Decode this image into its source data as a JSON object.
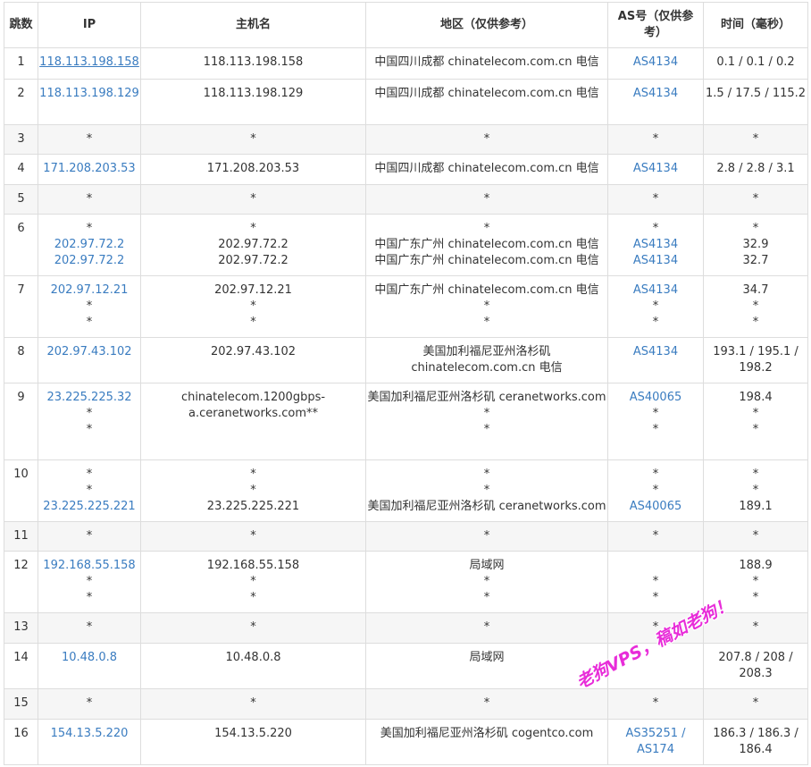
{
  "headers": {
    "hop": "跳数",
    "ip": "IP",
    "hostname": "主机名",
    "region": "地区（仅供参考）",
    "as": "AS号（仅供参考）",
    "time": "时间（毫秒）"
  },
  "rows": [
    {
      "hop": "1",
      "ip": [
        "118.113.198.158"
      ],
      "host": [
        "118.113.198.158"
      ],
      "region": [
        "中国四川成都 chinatelecom.com.cn 电信"
      ],
      "as": [
        "AS4134"
      ],
      "time": [
        "0.1 / 0.1 / 0.2"
      ]
    },
    {
      "hop": "2",
      "ip": [
        "118.113.198.129"
      ],
      "host": [
        "118.113.198.129"
      ],
      "region": [
        "中国四川成都 chinatelecom.com.cn 电信"
      ],
      "as": [
        "AS4134"
      ],
      "time": [
        "1.5 / 17.5 / 115.2"
      ]
    },
    {
      "hop": "3",
      "ip": [
        "*"
      ],
      "host": [
        "*"
      ],
      "region": [
        "*"
      ],
      "as": [
        "*"
      ],
      "time": [
        "*"
      ]
    },
    {
      "hop": "4",
      "ip": [
        "171.208.203.53"
      ],
      "host": [
        "171.208.203.53"
      ],
      "region": [
        "中国四川成都 chinatelecom.com.cn 电信"
      ],
      "as": [
        "AS4134"
      ],
      "time": [
        "2.8 / 2.8 / 3.1"
      ]
    },
    {
      "hop": "5",
      "ip": [
        "*"
      ],
      "host": [
        "*"
      ],
      "region": [
        "*"
      ],
      "as": [
        "*"
      ],
      "time": [
        "*"
      ]
    },
    {
      "hop": "6",
      "ip": [
        "*",
        "202.97.72.2",
        "202.97.72.2"
      ],
      "host": [
        "*",
        "202.97.72.2",
        "202.97.72.2"
      ],
      "region": [
        "*",
        "中国广东广州 chinatelecom.com.cn 电信",
        "中国广东广州 chinatelecom.com.cn 电信"
      ],
      "as": [
        "*",
        "AS4134",
        "AS4134"
      ],
      "time": [
        "*",
        "32.9",
        "32.7"
      ]
    },
    {
      "hop": "7",
      "ip": [
        "202.97.12.21",
        "*",
        "*"
      ],
      "host": [
        "202.97.12.21",
        "*",
        "*"
      ],
      "region": [
        "中国广东广州 chinatelecom.com.cn 电信",
        "*",
        "*"
      ],
      "as": [
        "AS4134",
        "*",
        "*"
      ],
      "time": [
        "34.7",
        "*",
        "*"
      ]
    },
    {
      "hop": "8",
      "ip": [
        "202.97.43.102"
      ],
      "host": [
        "202.97.43.102"
      ],
      "region": [
        "美国加利福尼亚州洛杉矶 chinatelecom.com.cn 电信"
      ],
      "as": [
        "AS4134"
      ],
      "time": [
        "193.1 / 195.1 / 198.2"
      ]
    },
    {
      "hop": "9",
      "ip": [
        "23.225.225.32",
        "*",
        "*"
      ],
      "host": [
        "chinatelecom.1200gbps-a.ceranetworks.com",
        "*",
        "*"
      ],
      "region": [
        "美国加利福尼亚州洛杉矶 ceranetworks.com",
        "*",
        "*"
      ],
      "as": [
        "AS40065",
        "*",
        "*"
      ],
      "time": [
        "198.4",
        "*",
        "*"
      ]
    },
    {
      "hop": "10",
      "ip": [
        "*",
        "*",
        "23.225.225.221"
      ],
      "host": [
        "*",
        "*",
        "23.225.225.221"
      ],
      "region": [
        "*",
        "*",
        "美国加利福尼亚州洛杉矶 ceranetworks.com"
      ],
      "as": [
        "*",
        "*",
        "AS40065"
      ],
      "time": [
        "*",
        "*",
        "189.1"
      ]
    },
    {
      "hop": "11",
      "ip": [
        "*"
      ],
      "host": [
        "*"
      ],
      "region": [
        "*"
      ],
      "as": [
        "*"
      ],
      "time": [
        "*"
      ]
    },
    {
      "hop": "12",
      "ip": [
        "192.168.55.158",
        "*",
        "*"
      ],
      "host": [
        "192.168.55.158",
        "*",
        "*"
      ],
      "region": [
        "局域网",
        "*",
        "*"
      ],
      "as": [
        "",
        "*",
        "*"
      ],
      "time": [
        "188.9",
        "*",
        "*"
      ]
    },
    {
      "hop": "13",
      "ip": [
        "*"
      ],
      "host": [
        "*"
      ],
      "region": [
        "*"
      ],
      "as": [
        "*"
      ],
      "time": [
        "*"
      ]
    },
    {
      "hop": "14",
      "ip": [
        "10.48.0.8"
      ],
      "host": [
        "10.48.0.8"
      ],
      "region": [
        "局域网"
      ],
      "as": [
        ""
      ],
      "time": [
        "207.8 / 208 / 208.3"
      ]
    },
    {
      "hop": "15",
      "ip": [
        "*"
      ],
      "host": [
        "*"
      ],
      "region": [
        "*"
      ],
      "as": [
        "*"
      ],
      "time": [
        "*"
      ]
    },
    {
      "hop": "16",
      "ip": [
        "154.13.5.220"
      ],
      "host": [
        "154.13.5.220"
      ],
      "region": [
        "美国加利福尼亚州洛杉矶 cogentco.com"
      ],
      "as": [
        "AS35251 / AS174"
      ],
      "time": [
        "186.3 / 186.3 / 186.4"
      ]
    }
  ],
  "watermark": "老狗VPS，稿如老狗！",
  "colors": {
    "link": "#3a7cc0",
    "border": "#dddddd",
    "alt_row": "#f6f6f6",
    "watermark": "#e82cd9"
  }
}
